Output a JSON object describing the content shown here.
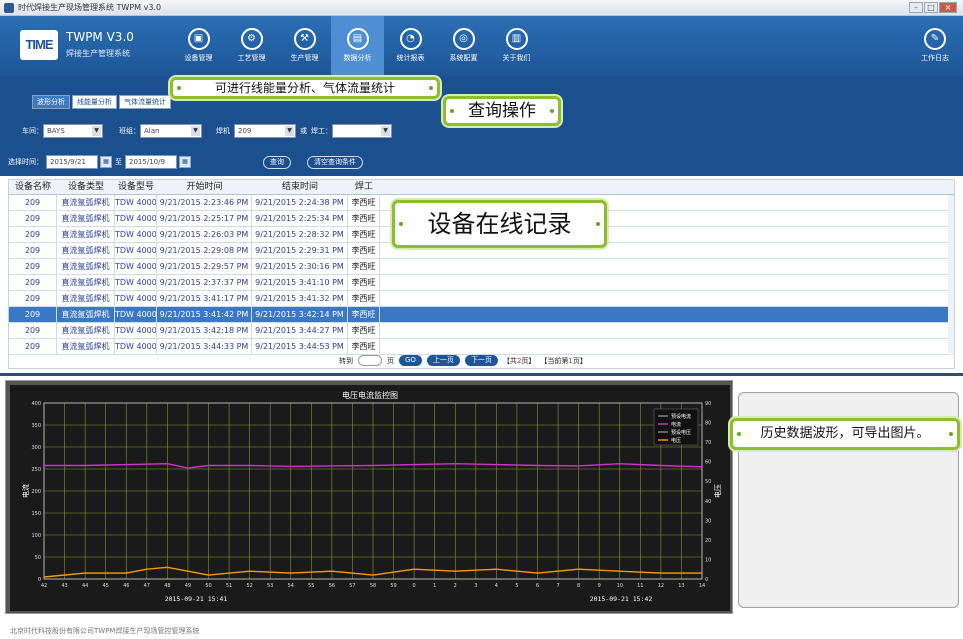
{
  "window": {
    "title": "时代焊接生产现场管理系统 TWPM v3.0",
    "buttons": [
      "–",
      "□",
      "×"
    ]
  },
  "brand": {
    "logo_text": "TIME",
    "name": "TWPM V3.0",
    "subtitle": "焊接生产管理系统"
  },
  "nav": {
    "items": [
      {
        "label": "设备管理",
        "icon": "device-icon",
        "glyph": "▣"
      },
      {
        "label": "工艺管理",
        "icon": "process-icon",
        "glyph": "⚙"
      },
      {
        "label": "生产管理",
        "icon": "production-icon",
        "glyph": "⚒"
      },
      {
        "label": "数据分析",
        "icon": "analysis-icon",
        "glyph": "▤",
        "active": true
      },
      {
        "label": "统计报表",
        "icon": "report-icon",
        "glyph": "◔"
      },
      {
        "label": "系统配置",
        "icon": "config-icon",
        "glyph": "◎"
      },
      {
        "label": "关于我们",
        "icon": "about-icon",
        "glyph": "▥"
      }
    ],
    "right": {
      "label": "工作日志",
      "icon": "log-icon",
      "glyph": "✎"
    }
  },
  "subtabs": [
    "波形分析",
    "线能量分析",
    "气体流量统计"
  ],
  "filters": {
    "workshop_label": "车间：",
    "workshop_value": "BAYS",
    "team_label": "班组：",
    "team_value": "Alan",
    "welder_machine_label": "焊机",
    "welder_machine_value": "209",
    "or_label": "或",
    "welder_label": "焊工：",
    "welder_value": "",
    "time_label": "选择时间：",
    "date_from": "2015/9/21",
    "to_label": "至",
    "date_to": "2015/10/9",
    "query_button": "查询",
    "clear_button": "清空查询条件"
  },
  "table": {
    "headers": [
      "设备名称",
      "设备类型",
      "设备型号",
      "开始时间",
      "结束时间",
      "焊工"
    ],
    "rows": [
      [
        "209",
        "直流氩弧焊机",
        "TDW 4000",
        "9/21/2015 2:23:46 PM",
        "9/21/2015 2:24:38 PM",
        "李西旺"
      ],
      [
        "209",
        "直流氩弧焊机",
        "TDW 4000",
        "9/21/2015 2:25:17 PM",
        "9/21/2015 2:25:34 PM",
        "李西旺"
      ],
      [
        "209",
        "直流氩弧焊机",
        "TDW 4000",
        "9/21/2015 2:26:03 PM",
        "9/21/2015 2:28:32 PM",
        "李西旺"
      ],
      [
        "209",
        "直流氩弧焊机",
        "TDW 4000",
        "9/21/2015 2:29:08 PM",
        "9/21/2015 2:29:31 PM",
        "李西旺"
      ],
      [
        "209",
        "直流氩弧焊机",
        "TDW 4000",
        "9/21/2015 2:29:57 PM",
        "9/21/2015 2:30:16 PM",
        "李西旺"
      ],
      [
        "209",
        "直流氩弧焊机",
        "TDW 4000",
        "9/21/2015 2:37:37 PM",
        "9/21/2015 3:41:10 PM",
        "李西旺"
      ],
      [
        "209",
        "直流氩弧焊机",
        "TDW 4000",
        "9/21/2015 3:41:17 PM",
        "9/21/2015 3:41:32 PM",
        "李西旺"
      ],
      [
        "209",
        "直流氩弧焊机",
        "TDW 4000",
        "9/21/2015 3:41:42 PM",
        "9/21/2015 3:42:14 PM",
        "李西旺"
      ],
      [
        "209",
        "直流氩弧焊机",
        "TDW 4000",
        "9/21/2015 3:42:18 PM",
        "9/21/2015 3:44:27 PM",
        "李西旺"
      ],
      [
        "209",
        "直流氩弧焊机",
        "TDW 4000",
        "9/21/2015 3:44:33 PM",
        "9/21/2015 3:44:53 PM",
        "李西旺"
      ]
    ],
    "selected_row": 7
  },
  "pager": {
    "goto_label": "转到",
    "page_label": "页",
    "go_button": "GO",
    "prev_button": "上一页",
    "next_button": "下一页",
    "total_prefix": "【共",
    "total_pages": "2",
    "total_suffix": "页】",
    "current_prefix": "【当前第",
    "current_page": "1",
    "current_suffix": "页】"
  },
  "callouts": {
    "features": "可进行线能量分析、气体流量统计",
    "query": "查询操作",
    "records": "设备在线记录",
    "waveform": "历史数据波形，可导出图片。"
  },
  "footer": "北京时代科技股份有限公司TWPM焊接生产现场管控管理系统",
  "colors": {
    "header": "#1d5597",
    "accent": "#3a78c3",
    "callout_border": "#8bbf2f",
    "voltage": "#ff9900",
    "current": "#cc33cc"
  },
  "chart_data": {
    "type": "line",
    "title": "电压电流监控图",
    "ylabel": "电流",
    "y2label": "电压",
    "ylim": [
      0,
      400
    ],
    "y2lim": [
      0,
      90
    ],
    "yticks": [
      0,
      50,
      100,
      150,
      200,
      250,
      300,
      350,
      400
    ],
    "y2ticks": [
      0,
      10,
      20,
      30,
      40,
      50,
      60,
      70,
      80,
      90
    ],
    "xlim": [
      42,
      15
    ],
    "xticks": [
      42,
      43,
      44,
      45,
      46,
      47,
      48,
      49,
      50,
      51,
      52,
      53,
      54,
      55,
      56,
      57,
      58,
      59,
      0,
      1,
      2,
      3,
      4,
      5,
      6,
      7,
      8,
      9,
      10,
      11,
      12,
      13,
      14
    ],
    "date_labels": [
      "2015-09-21 15:41",
      "2015-09-21 15:42"
    ],
    "legend": {
      "position": "top-right",
      "entries": [
        "预设电流",
        "电流",
        "预设电压",
        "电压"
      ]
    },
    "grid": true,
    "series": [
      {
        "name": "电流",
        "axis": "left",
        "color": "#cc33cc",
        "x": [
          0,
          2,
          4,
          6,
          7,
          8,
          10,
          12,
          14,
          16,
          18,
          20,
          22,
          24,
          26,
          28,
          30,
          32
        ],
        "values": [
          258,
          258,
          260,
          262,
          252,
          258,
          258,
          256,
          257,
          258,
          260,
          262,
          260,
          258,
          257,
          262,
          258,
          255
        ]
      },
      {
        "name": "电压",
        "axis": "right",
        "color": "#ff9900",
        "x": [
          0,
          2,
          4,
          5,
          6,
          8,
          10,
          12,
          14,
          16,
          18,
          20,
          22,
          24,
          26,
          28,
          30,
          32
        ],
        "values": [
          1,
          3,
          3,
          5,
          6,
          2,
          4,
          3,
          4,
          2,
          5,
          4,
          5,
          3,
          5,
          4,
          3,
          3
        ]
      }
    ]
  }
}
